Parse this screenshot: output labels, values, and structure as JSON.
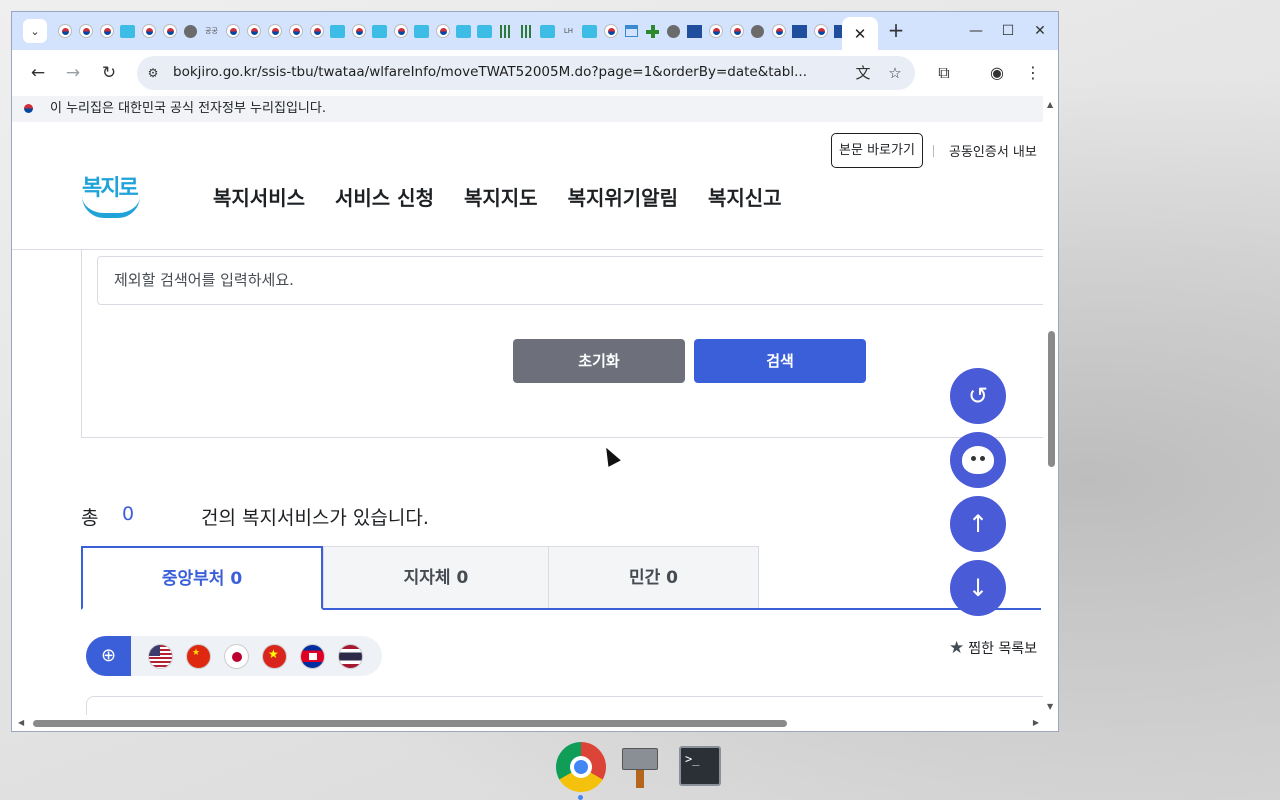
{
  "browser": {
    "url": "bokjiro.go.kr/ssis-tbu/twataa/wlfareInfo/moveTWAT52005M.do?page=1&orderBy=date&tabl...",
    "favicons": [
      "flag",
      "flag",
      "flag",
      "bok",
      "flag",
      "flag",
      "globe",
      "text",
      "flag",
      "flag",
      "flag",
      "flag",
      "flag",
      "bok",
      "flag",
      "bok",
      "flag",
      "bok",
      "flag",
      "bok",
      "bok",
      "bars",
      "bars",
      "bok",
      "text",
      "bok",
      "flag",
      "house",
      "plus",
      "globe",
      "blue",
      "flag",
      "flag",
      "globe",
      "flag",
      "blue",
      "flag",
      "blue",
      "flag"
    ],
    "favicon_text_1": "공공",
    "favicon_text_2": "LH",
    "tab_close": "✕",
    "new_tab": "+",
    "minimize": "—",
    "maximize": "☐",
    "close": "✕"
  },
  "page": {
    "gov_banner": "이 누리집은 대한민국 공식 전자정부 누리집입니다.",
    "skip_link": "본문 바로가기",
    "cert_link": "공동인증서 내보",
    "logo_text": "복지로",
    "gnb": [
      "복지서비스",
      "서비스 신청",
      "복지지도",
      "복지위기알림",
      "복지신고"
    ],
    "exclude_placeholder": "제외할 검색어를 입력하세요.",
    "reset_label": "초기화",
    "search_label": "검색",
    "result_prefix": "총",
    "result_count": "0",
    "result_suffix": "건의 복지서비스가 있습니다.",
    "tabs": [
      "중앙부처 0",
      "지자체 0",
      "민간 0"
    ],
    "active_tab": 0,
    "favorites_label": "찜한 목록보",
    "languages": [
      "us",
      "cn",
      "jp",
      "vn",
      "kh",
      "th"
    ]
  },
  "colors": {
    "accent": "#3b5fd9",
    "reset": "#6d6f7b",
    "floating": "#4a5bd8",
    "tabstrip": "#d3e3fd"
  },
  "taskbar": {
    "terminal_prompt": ">_"
  }
}
